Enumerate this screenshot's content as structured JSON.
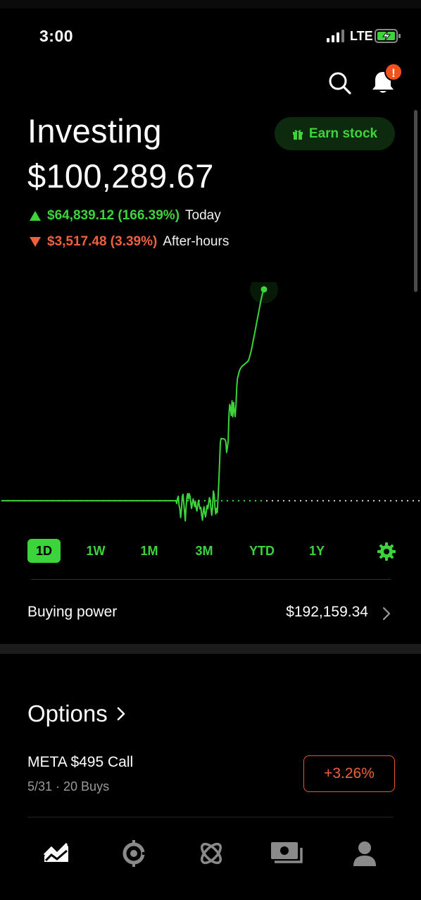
{
  "status_bar": {
    "time": "3:00",
    "network": "LTE"
  },
  "header": {
    "title": "Investing",
    "total_value": "$100,289.67",
    "earn_button": "Earn stock",
    "notification_badge": "!"
  },
  "changes": {
    "today": {
      "amount": "$64,839.12 (166.39%)",
      "label": "Today",
      "direction": "up"
    },
    "after_hours": {
      "amount": "$3,517.48 (3.39%)",
      "label": "After-hours",
      "direction": "down"
    }
  },
  "colors": {
    "gain": "#3bd43b",
    "loss": "#f0603c",
    "background": "#000000"
  },
  "chart_data": {
    "type": "line",
    "series": [
      {
        "values": [
          35644,
          35644,
          35644,
          35644,
          35644,
          35644,
          35644,
          35644,
          35644,
          35644,
          35644,
          35644,
          35644,
          35644,
          35644,
          35644,
          35644,
          35644,
          35644,
          35644,
          35644,
          35644,
          35644,
          35644,
          35644,
          35644,
          35644,
          35644,
          35644,
          35644,
          35644,
          35644,
          35644,
          35644,
          35644,
          35644,
          35644,
          35644,
          35644,
          35644,
          35644,
          35644,
          35644,
          35644,
          35644,
          35644,
          35644,
          35644,
          35644,
          35644,
          35644,
          35644,
          35644,
          35644,
          35644,
          35644,
          35644,
          35644,
          35644,
          35644,
          35644,
          35644,
          35644,
          35644,
          35644,
          35644,
          35644,
          35644,
          35644,
          35644,
          35644,
          35644,
          35644,
          35644,
          35644,
          35644,
          35644,
          35644,
          35644,
          35644,
          35644,
          35644,
          35644,
          35644,
          35644,
          35644,
          35644,
          35644,
          35644,
          35644,
          35644,
          35644,
          35644,
          35644,
          35644,
          35644,
          35644,
          35644,
          35644,
          35644,
          35644,
          35644,
          35644,
          35644,
          35644,
          35644,
          35644,
          35644,
          35644,
          35644,
          35644,
          35644,
          35644,
          35644,
          35644,
          35644,
          35644,
          35644,
          35644,
          35644,
          35644,
          35644,
          35644,
          35644,
          35644,
          35644,
          35644,
          35644,
          35644,
          35644,
          35644,
          35644,
          35644,
          35644,
          35644,
          35644,
          35644,
          35644,
          35644,
          35644,
          35644,
          35644,
          35644,
          35644,
          35644,
          35644,
          35644,
          35644,
          35644,
          35644,
          35644,
          35644,
          35644,
          35644,
          35644,
          35644,
          35644,
          35644,
          35644,
          35644,
          35644,
          35644,
          35644,
          35644,
          35644,
          35644,
          35644,
          35644,
          35644,
          35644,
          35644,
          35644,
          35644,
          35644,
          35644,
          35644,
          35644,
          35644,
          35644,
          35644,
          35644,
          35644,
          35644,
          35644,
          35644,
          35644,
          35644,
          35644,
          35644,
          35644,
          35644,
          35644,
          35644,
          35644,
          35644,
          35644,
          35644,
          35644,
          35644,
          35644,
          35644,
          35644,
          35644,
          35644,
          35644,
          35644,
          35644,
          35644,
          35644,
          35644,
          35644,
          35644,
          35644,
          35644,
          35644,
          35644,
          35644,
          35644,
          35644,
          35644,
          35644,
          35644,
          35644,
          35644,
          35700,
          34800,
          36300,
          37000,
          34200,
          33100,
          30500,
          32900,
          36800,
          37600,
          35100,
          32300,
          29500,
          33600,
          36600,
          37800,
          36200,
          37800,
          37000,
          35000,
          33300,
          34800,
          36200,
          35100,
          33900,
          35500,
          33300,
          32500,
          34400,
          35800,
          34200,
          33100,
          33600,
          31100,
          29700,
          32400,
          33800,
          31700,
          30700,
          32600,
          34200,
          33200,
          35000,
          36600,
          35600,
          33100,
          31200,
          33700,
          38600,
          37500,
          33700,
          31600,
          33300,
          32000,
          36500,
          41200,
          47300,
          53500,
          54700,
          54600,
          54600,
          54600,
          54500,
          54300,
          53600,
          50400,
          51900,
          53800,
          61800,
          65100,
          64000,
          61700,
          66200,
          61300,
          65700,
          63100,
          61400,
          64900,
          70500,
          73200,
          74000,
          75000,
          75700,
          76100,
          76500,
          76800,
          77000,
          77200,
          77400,
          77600,
          77800,
          78000,
          78200,
          78600,
          79200,
          80100,
          81000,
          82000,
          83200,
          84400,
          85600,
          86800,
          88000,
          89300,
          90600,
          91800,
          93100,
          94400,
          95700,
          96900,
          98000,
          99000,
          99700,
          100289.67
        ]
      }
    ],
    "baseline": 35644,
    "ylim": [
      27000,
      102500
    ],
    "grid": false,
    "legend": "none"
  },
  "ranges": {
    "items": [
      "1D",
      "1W",
      "1M",
      "3M",
      "YTD",
      "1Y"
    ],
    "active": "1D"
  },
  "buying_power": {
    "label": "Buying power",
    "value": "$192,159.34"
  },
  "options": {
    "title": "Options",
    "item": {
      "name": "META $495 Call",
      "sub": "5/31 · 20 Buys",
      "change": "+3.26%"
    }
  },
  "nav": {
    "items": [
      "investing-icon",
      "crypto-icon",
      "explore-icon",
      "transfers-icon",
      "account-icon"
    ],
    "active": "investing-icon"
  }
}
